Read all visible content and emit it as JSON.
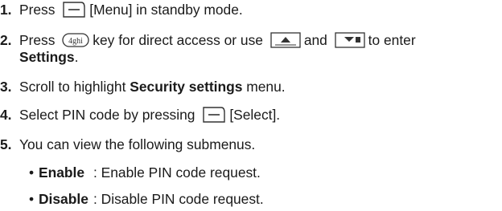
{
  "steps": [
    {
      "num": "1.",
      "before": "Press",
      "after": "[Menu] in standby mode."
    },
    {
      "num": "2.",
      "before": "Press",
      "mid1": "key for direct access or use",
      "mid2": "and",
      "after": "to enter",
      "cont": "Settings",
      "cont_tail": "."
    },
    {
      "num": "3.",
      "before": "Scroll to highlight",
      "bold": "Security settings",
      "after": "menu."
    },
    {
      "num": "4.",
      "before": "Select PIN code by pressing",
      "after": "[Select]."
    },
    {
      "num": "5.",
      "text": "You can view the following submenus."
    }
  ],
  "submenus": [
    {
      "bullet": "•",
      "term": "Enable",
      "desc": ": Enable PIN code request."
    },
    {
      "bullet": "•",
      "term": "Disable",
      "desc": ": Disable PIN code request."
    }
  ],
  "icons": {
    "soft_key": "soft-key-icon",
    "key_4": "key-4ghi-icon",
    "nav_up": "nav-up-key-icon",
    "nav_down": "nav-down-key-icon"
  },
  "key_4_label": "4ghi"
}
